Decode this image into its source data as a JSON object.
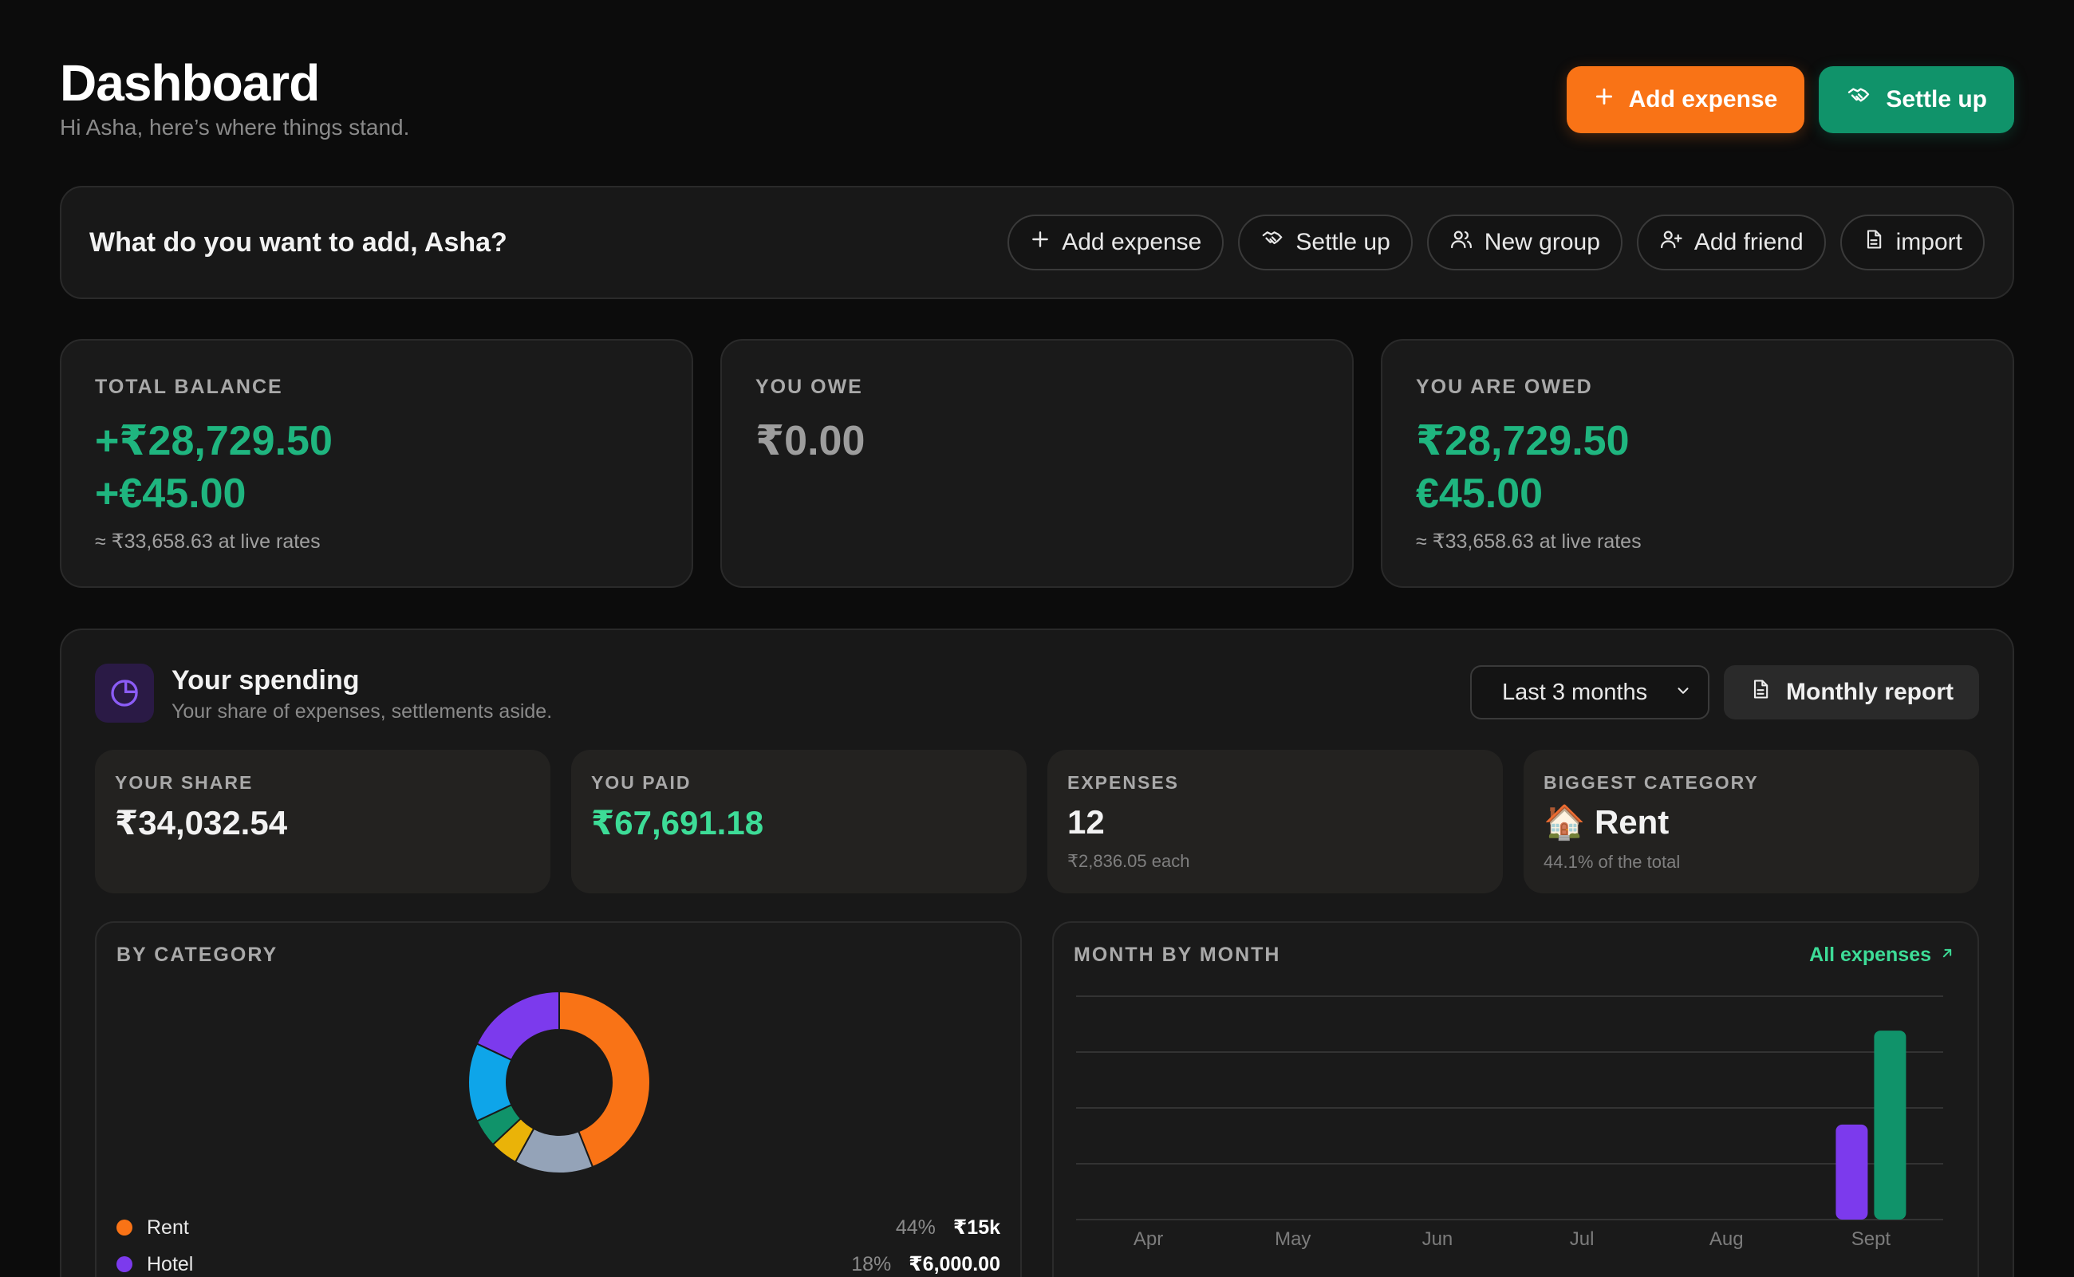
{
  "header": {
    "title": "Dashboard",
    "subtitle": "Hi Asha, here’s where things stand.",
    "add_expense_label": "Add expense",
    "settle_up_label": "Settle up"
  },
  "quick_add": {
    "prompt": "What do you want to add, Asha?",
    "actions": [
      {
        "label": "Add expense",
        "icon": "plus-icon"
      },
      {
        "label": "Settle up",
        "icon": "handshake-icon"
      },
      {
        "label": "New group",
        "icon": "users-icon"
      },
      {
        "label": "Add friend",
        "icon": "user-plus-icon"
      },
      {
        "label": "import",
        "icon": "file-icon"
      }
    ]
  },
  "stats": {
    "total_balance": {
      "label": "TOTAL BALANCE",
      "amounts": [
        "+₹28,729.50",
        "+€45.00"
      ],
      "note": "≈ ₹33,658.63 at live rates"
    },
    "you_owe": {
      "label": "YOU OWE",
      "amounts": [
        "₹0.00"
      ]
    },
    "you_are_owed": {
      "label": "YOU ARE OWED",
      "amounts": [
        "₹28,729.50",
        "€45.00"
      ],
      "note": "≈ ₹33,658.63 at live rates"
    }
  },
  "spending": {
    "title": "Your spending",
    "subtitle": "Your share of expenses, settlements aside.",
    "range_selected": "Last 3 months",
    "report_label": "Monthly report",
    "mini": {
      "your_share": {
        "label": "YOUR SHARE",
        "value": "₹34,032.54"
      },
      "you_paid": {
        "label": "YOU PAID",
        "value": "₹67,691.18"
      },
      "expenses": {
        "label": "EXPENSES",
        "value": "12",
        "note": "₹2,836.05 each"
      },
      "biggest": {
        "label": "BIGGEST CATEGORY",
        "value": "🏠 Rent",
        "note": "44.1% of the total"
      }
    },
    "by_category": {
      "label": "BY CATEGORY",
      "legend": [
        {
          "name": "Rent",
          "pct": "44%",
          "amount": "₹15k",
          "color": "#f97316"
        },
        {
          "name": "Hotel",
          "pct": "18%",
          "amount": "₹6,000.00",
          "color": "#7c3aed"
        }
      ]
    },
    "month_by_month": {
      "label": "MONTH BY MONTH",
      "link_label": "All expenses"
    }
  },
  "chart_data": [
    {
      "type": "pie",
      "title": "BY CATEGORY",
      "donut": true,
      "series": [
        {
          "name": "Rent",
          "value": 44,
          "color": "#f97316"
        },
        {
          "name": "",
          "value": 14,
          "color": "#94a3b8"
        },
        {
          "name": "",
          "value": 5,
          "color": "#eab308"
        },
        {
          "name": "",
          "value": 5,
          "color": "#10936a"
        },
        {
          "name": "",
          "value": 14,
          "color": "#0ea5e9"
        },
        {
          "name": "Hotel",
          "value": 18,
          "color": "#7c3aed"
        }
      ]
    },
    {
      "type": "bar",
      "title": "MONTH BY MONTH",
      "categories": [
        "Apr",
        "May",
        "Jun",
        "Jul",
        "Aug",
        "Sept"
      ],
      "series": [
        {
          "values": [
            0,
            0,
            0,
            0,
            0,
            34032.54
          ],
          "color": "#7c3aed"
        },
        {
          "values": [
            0,
            0,
            0,
            0,
            0,
            67691.18
          ],
          "color": "#10936a"
        }
      ],
      "ylim": [
        0,
        80000
      ],
      "grid": true
    }
  ]
}
